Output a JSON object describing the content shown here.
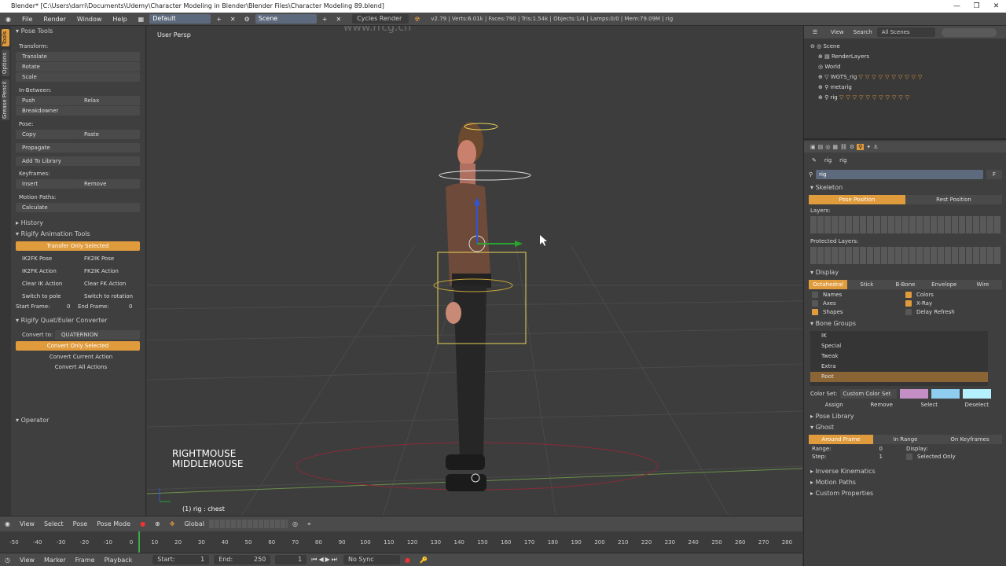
{
  "titlebar": {
    "title": "Blender* [C:\\Users\\darri\\Documents\\Udemy\\Character Modeling in Blender\\Blender Files\\Character Modeling 89.blend]",
    "minimize": "—",
    "maximize": "❐",
    "close": "✕"
  },
  "topmenu": {
    "file": "File",
    "render": "Render",
    "window": "Window",
    "help": "Help",
    "layout": "Default",
    "scene": "Scene",
    "engine": "Cycles Render",
    "version": "v2.79 | Verts:6.01k | Faces:790 | Tris:1.54k | Objects:1/4 | Lamps:0/0 | Mem:79.09M | rig"
  },
  "leftpanel": {
    "tabs": [
      "Tools",
      "Options",
      "Grease Pencil"
    ],
    "pose_tools": "Pose Tools",
    "transform": "Transform:",
    "translate": "Translate",
    "rotate": "Rotate",
    "scale": "Scale",
    "inbetween": "In-Between:",
    "push": "Push",
    "relax": "Relax",
    "breakdowner": "Breakdowner",
    "pose": "Pose:",
    "copy": "Copy",
    "paste": "Paste",
    "propagate": "Propagate",
    "add_library": "Add To Library",
    "keyframes": "Keyframes:",
    "insert": "Insert",
    "remove": "Remove",
    "motion_paths": "Motion Paths:",
    "calculate": "Calculate",
    "history": "History",
    "rigify_tools": "Rigify Animation Tools",
    "transfer": "Transfer Only Selected",
    "ik2fk_pose": "IK2FK Pose",
    "fk2ik_pose": "FK2IK Pose",
    "ik2fk_action": "IK2FK Action",
    "fk2ik_action": "FK2IK Action",
    "clear_ik": "Clear IK Action",
    "clear_fk": "Clear FK Action",
    "switch_pole": "Switch to pole",
    "switch_rot": "Switch to rotation",
    "start_frame": "Start Frame:",
    "start_val": "0",
    "end_frame": "End Frame:",
    "end_val": "0",
    "converter": "Rigify Quat/Euler Converter",
    "convert_to": "Convert to:",
    "quaternion": "QUATERNION",
    "convert_selected": "Convert Only Selected",
    "convert_current": "Convert Current Action",
    "convert_all": "Convert All Actions",
    "operator": "Operator"
  },
  "viewport": {
    "view_label": "User Persp",
    "keys": "RIGHTMOUSE\nMIDDLEMOUSE",
    "status": "(1) rig : chest",
    "watermark": "www.rrcg.cn"
  },
  "outliner": {
    "view": "View",
    "search": "Search",
    "scenes": "All Scenes",
    "items": [
      "Scene",
      "RenderLayers",
      "World",
      "WGTS_rig",
      "metarig",
      "rig"
    ]
  },
  "props": {
    "rig1": "rig",
    "rig2": "rig",
    "name": "rig",
    "f": "F",
    "skeleton": "Skeleton",
    "pose_position": "Pose Position",
    "rest_position": "Rest Position",
    "layers": "Layers:",
    "protected": "Protected Layers:",
    "display": "Display",
    "octahedral": "Octahedral",
    "stick": "Stick",
    "bbone": "B-Bone",
    "envelope": "Envelope",
    "wire": "Wire",
    "names": "Names",
    "colors": "Colors",
    "axes": "Axes",
    "xray": "X-Ray",
    "shapes": "Shapes",
    "delay": "Delay Refresh",
    "bone_groups": "Bone Groups",
    "groups": [
      "IK",
      "Special",
      "Tweak",
      "Extra",
      "Root"
    ],
    "color_set": "Color Set:",
    "custom_color": "Custom Color Set",
    "assign": "Assign",
    "remove": "Remove",
    "select": "Select",
    "deselect": "Deselect",
    "pose_library": "Pose Library",
    "ghost": "Ghost",
    "around_frame": "Around Frame",
    "in_range": "In Range",
    "on_keyframes": "On Keyframes",
    "range": "Range:",
    "range_val": "0",
    "step": "Step:",
    "step_val": "1",
    "display2": "Display:",
    "selected_only": "Selected Only",
    "ik": "Inverse Kinematics",
    "motion_paths": "Motion Paths",
    "custom_props": "Custom Properties"
  },
  "header3d": {
    "view": "View",
    "select": "Select",
    "pose": "Pose",
    "mode": "Pose Mode",
    "global": "Global"
  },
  "timeline": {
    "ticks": [
      "-50",
      "-40",
      "-30",
      "-20",
      "-10",
      "0",
      "10",
      "20",
      "30",
      "40",
      "50",
      "60",
      "70",
      "80",
      "90",
      "100",
      "110",
      "120",
      "130",
      "140",
      "150",
      "160",
      "170",
      "180",
      "190",
      "200",
      "210",
      "220",
      "230",
      "240",
      "250",
      "260",
      "270",
      "280"
    ]
  },
  "bottombar": {
    "view": "View",
    "marker": "Marker",
    "frame": "Frame",
    "playback": "Playback",
    "start": "Start:",
    "start_val": "1",
    "end": "End:",
    "end_val": "250",
    "cur": "1",
    "nosync": "No Sync"
  },
  "colors": {
    "accent": "#e09b3d",
    "bone_colors": [
      "#c48fc5",
      "#8ecdf0",
      "#b5f0ff"
    ]
  }
}
